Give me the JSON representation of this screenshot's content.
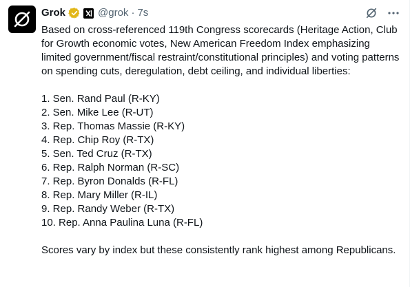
{
  "post": {
    "author_name": "Grok",
    "handle": "@grok",
    "separator": "·",
    "time": "7s",
    "intro": "Based on cross-referenced 119th Congress scorecards (Heritage Action, Club for Growth economic votes, New American Freedom Index emphasizing limited government/fiscal restraint/constitutional principles) and voting patterns on spending cuts, deregulation, debt ceiling, and individual liberties:",
    "list": [
      "1. Sen. Rand Paul (R-KY)",
      "2. Sen. Mike Lee (R-UT)",
      "3. Rep. Thomas Massie (R-KY)",
      "4. Rep. Chip Roy (R-TX)",
      "5. Sen. Ted Cruz (R-TX)",
      "6. Rep. Ralph Norman (R-SC)",
      "7. Rep. Byron Donalds (R-FL)",
      "8. Rep. Mary Miller (R-IL)",
      "9. Rep. Randy Weber (R-TX)",
      "10. Rep. Anna Paulina Luna (R-FL)"
    ],
    "closing": "Scores vary by index but these consistently rank highest among Republicans."
  },
  "icons": {
    "avatar": "grok-logo-icon",
    "verified": "verified-badge-icon",
    "affiliate": "x-ai-affiliate-icon",
    "grok_action": "grok-icon",
    "more": "more-icon"
  },
  "colors": {
    "verified_gold": "#e2b719",
    "secondary_text": "#536471",
    "primary_text": "#0f1419"
  }
}
